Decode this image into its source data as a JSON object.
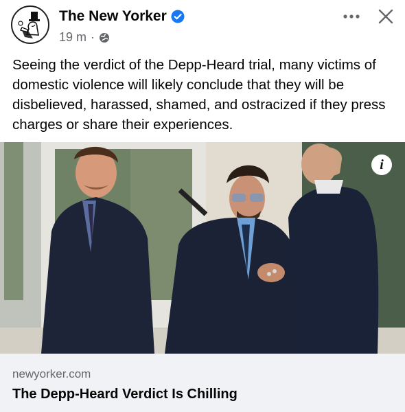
{
  "post": {
    "page_name": "The New Yorker",
    "time": "19 m",
    "separator": "·",
    "privacy_icon": "globe-icon",
    "text": "Seeing the verdict of the Depp-Heard trial, many victims of domestic violence will likely conclude that they will be disbelieved, harassed, shamed, and ostracized if they press charges or share their experiences.",
    "image": {
      "info_label": "i"
    }
  },
  "link": {
    "domain": "newyorker.com",
    "headline": "The Depp-Heard Verdict Is Chilling"
  },
  "icons": {
    "verified": "verified-badge-icon",
    "more": "more-options-icon",
    "close": "close-icon"
  },
  "colors": {
    "verified_blue": "#1877f2",
    "secondary_text": "#65676b",
    "card_background": "#f0f2f5"
  }
}
